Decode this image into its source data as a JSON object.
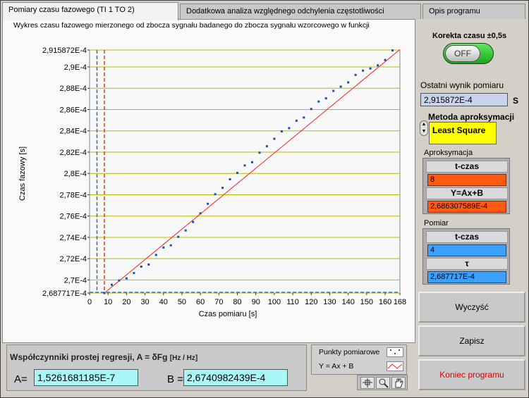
{
  "tabs": [
    {
      "label": "Pomiary czasu fazowego (TI 1 TO 2)",
      "active": true
    },
    {
      "label": "Dodatkowa analiza względnego odchylenia częstotliwości",
      "active": false
    },
    {
      "label": "Opis programu",
      "active": false
    }
  ],
  "graph": {
    "title": "Wykres czasu fazowego mierzonego od zbocza sygnału badanego do zbocza sygnału wzorcowego w funkcji",
    "ylabel": "Czas fazowy [s]",
    "xlabel": "Czas pomiaru [s]"
  },
  "chart_data": {
    "type": "scatter",
    "xlabel": "Czas pomiaru [s]",
    "ylabel": "Czas fazowy [s]",
    "xlim": [
      0,
      168
    ],
    "ylim": [
      0.0002687717,
      0.0002915872
    ],
    "x_ticks": [
      "0",
      "10",
      "20",
      "30",
      "40",
      "50",
      "60",
      "70",
      "80",
      "90",
      "100",
      "110",
      "120",
      "130",
      "140",
      "150",
      "160",
      "168"
    ],
    "y_ticks": [
      "2,687717E-4",
      "2,7E-4",
      "2,72E-4",
      "2,74E-4",
      "2,76E-4",
      "2,78E-4",
      "2,8E-4",
      "2,82E-4",
      "2,84E-4",
      "2,86E-4",
      "2,88E-4",
      "2,9E-4",
      "2,915872E-4"
    ],
    "grid": true,
    "series": [
      {
        "name": "Punkty pomiarowe",
        "kind": "points",
        "color": "#1a4fb5",
        "x": [
          8,
          12,
          16,
          20,
          24,
          28,
          32,
          36,
          40,
          44,
          48,
          52,
          56,
          60,
          64,
          68,
          72,
          76,
          80,
          84,
          88,
          92,
          96,
          100,
          104,
          108,
          112,
          116,
          120,
          124,
          128,
          132,
          136,
          140,
          144,
          148,
          152,
          156,
          160,
          164
        ],
        "y": [
          0.00026877,
          0.00026955,
          0.00026995,
          0.00027015,
          0.00027065,
          0.00027125,
          0.00027145,
          0.00027235,
          0.00027305,
          0.00027325,
          0.00027405,
          0.00027465,
          0.00027545,
          0.00027625,
          0.00027715,
          0.00027805,
          0.00027865,
          0.00027945,
          0.00028005,
          0.00028075,
          0.00028105,
          0.00028195,
          0.00028255,
          0.00028325,
          0.00028395,
          0.00028425,
          0.00028495,
          0.00028525,
          0.00028605,
          0.00028675,
          0.00028705,
          0.00028775,
          0.00028815,
          0.00028855,
          0.00028925,
          0.00028965,
          0.00028985,
          0.00029015,
          0.00029065,
          0.00029155
        ]
      },
      {
        "name": "Y = Ax + B",
        "kind": "line",
        "color": "#ff2020",
        "x": [
          8,
          168
        ],
        "y": [
          0.0002687717,
          0.000291636
        ]
      }
    ],
    "cursors": [
      {
        "x": 4,
        "color": "#1e78c8"
      },
      {
        "x": 8,
        "color": "#e04000"
      }
    ]
  },
  "regression": {
    "title": "Współczynniki prostej regresji, A = δFg",
    "unit": "[Hz / Hz]",
    "a_label": "A=",
    "a_value": "1,5261681185E-7",
    "b_label": "B =",
    "b_value": "2,6740982439E-4"
  },
  "legend": {
    "points_label": "Punkty pomiarowe",
    "line_label": "Y = Ax + B"
  },
  "right": {
    "korekta_label": "Korekta czasu ±0,5s",
    "toggle_text": "OFF",
    "ostatni_label": "Ostatni wynik pomiaru",
    "ostatni_value": "2,915872E-4",
    "unit_s": "S",
    "metoda_label": "Metoda aproksymacji",
    "metoda_value": "Least Square",
    "aproks_label": "Aproksymacja",
    "aproks_tczas_head": "t-czas",
    "aproks_tczas_value": "8",
    "aproks_eq_head": "Y=Ax+B",
    "aproks_eq_value": "2,686307589E-4",
    "pomiar_label": "Pomiar",
    "pomiar_tczas_head": "t-czas",
    "pomiar_tczas_value": "4",
    "pomiar_tau_head": "τ",
    "pomiar_tau_value": "2,687717E-4"
  },
  "buttons": {
    "clear": "Wyczyść",
    "save": "Zapisz",
    "stop": "Koniec programu"
  },
  "colors": {
    "accent_orange": "#ff5a14",
    "accent_blue": "#3ba0ff",
    "method_yellow": "#ffff00",
    "value_cyan": "#a9f8f8"
  }
}
